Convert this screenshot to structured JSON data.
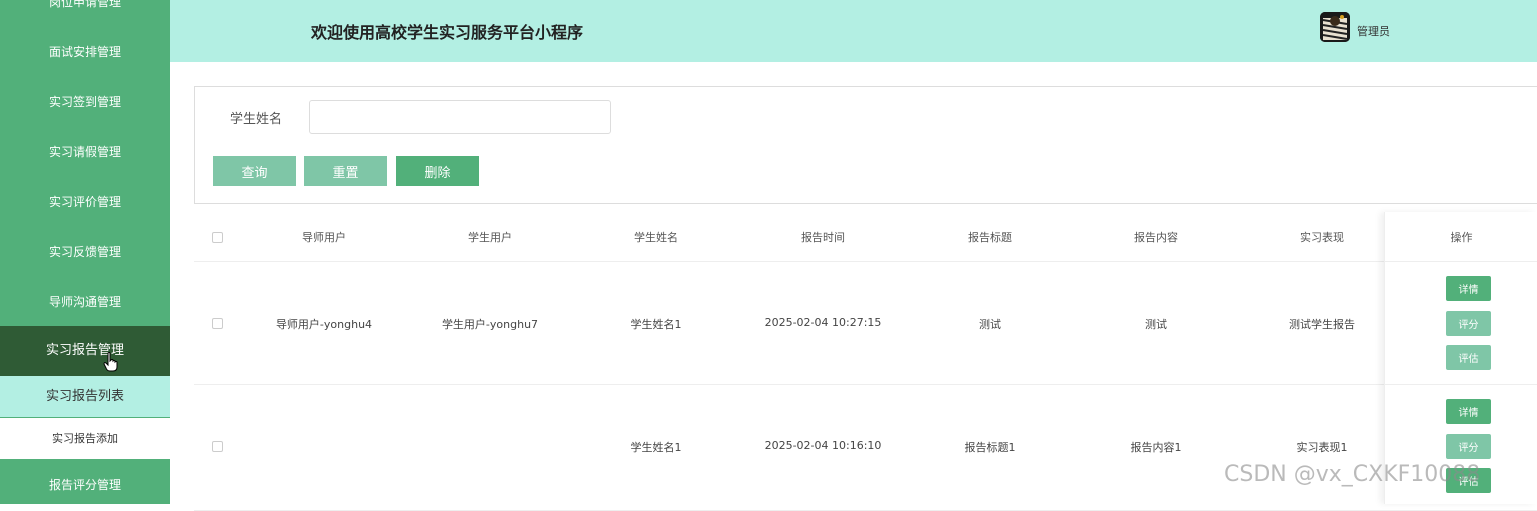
{
  "sidebar": {
    "items": [
      {
        "label": "岗位申请管理"
      },
      {
        "label": "面试安排管理"
      },
      {
        "label": "实习签到管理"
      },
      {
        "label": "实习请假管理"
      },
      {
        "label": "实习评价管理"
      },
      {
        "label": "实习反馈管理"
      },
      {
        "label": "导师沟通管理"
      },
      {
        "label": "实习报告管理"
      },
      {
        "label": "报告评分管理"
      }
    ],
    "submenu": [
      {
        "label": "实习报告列表"
      },
      {
        "label": "实习报告添加"
      }
    ]
  },
  "header": {
    "title": "欢迎使用高校学生实习服务平台小程序",
    "user": "管理员"
  },
  "search": {
    "label": "学生姓名",
    "value": "",
    "query_label": "查询",
    "reset_label": "重置",
    "delete_label": "删除"
  },
  "table": {
    "columns": [
      "导师用户",
      "学生用户",
      "学生姓名",
      "报告时间",
      "报告标题",
      "报告内容",
      "实习表现",
      "操作"
    ],
    "rows": [
      {
        "tutor": "导师用户-yonghu4",
        "student": "学生用户-yonghu7",
        "name": "学生姓名1",
        "time": "2025-02-04 10:27:15",
        "title": "测试",
        "content": "测试",
        "performance": "测试学生报告"
      },
      {
        "tutor": "",
        "student": "",
        "name": "学生姓名1",
        "time": "2025-02-04 10:16:10",
        "title": "报告标题1",
        "content": "报告内容1",
        "performance": "实习表现1"
      }
    ],
    "actions": {
      "detail": "详情",
      "score": "评分",
      "evaluate": "评估"
    }
  },
  "watermark": "CSDN @vx_CXKF10088"
}
